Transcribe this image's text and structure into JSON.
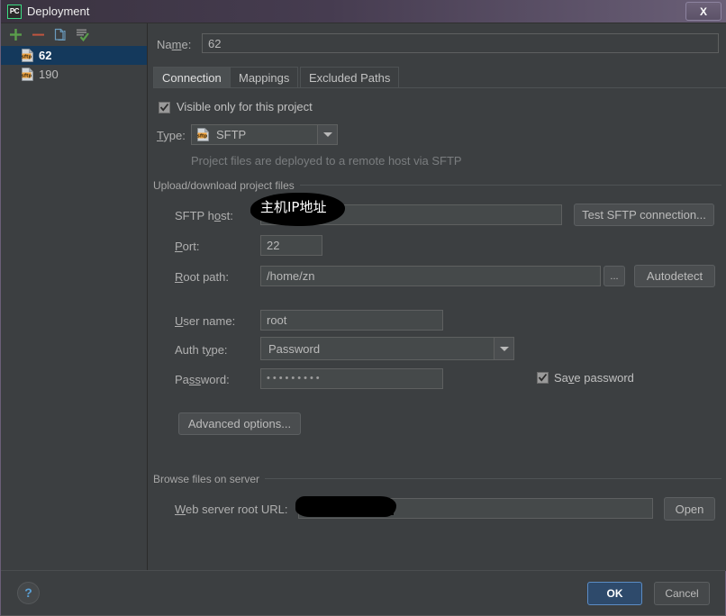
{
  "window": {
    "title": "Deployment",
    "app_icon": "pycharm-icon",
    "app_icon_text": "PC",
    "close_label": "X"
  },
  "toolbar": {
    "add": "add-icon",
    "remove": "remove-icon",
    "copy": "copy-icon",
    "set_default": "set-default-icon"
  },
  "server_list": {
    "items": [
      {
        "label": "62",
        "icon": "sftp-icon",
        "selected": true
      },
      {
        "label": "190",
        "icon": "sftp-icon",
        "selected": false
      }
    ]
  },
  "name_row": {
    "label_pre": "Na",
    "label_mnemonic": "m",
    "label_post": "e:",
    "value": "62"
  },
  "tabs": [
    {
      "label": "Connection",
      "active": true
    },
    {
      "label": "Mappings",
      "active": false
    },
    {
      "label": "Excluded Paths",
      "active": false
    }
  ],
  "connection": {
    "visible_only_checkbox": {
      "label": "Visible only for this project",
      "checked": true
    },
    "type_row": {
      "label_pre": "",
      "label_mnemonic": "T",
      "label_post": "ype:",
      "value": "SFTP",
      "icon": "sftp-icon"
    },
    "type_hint": "Project files are deployed to a remote host via SFTP",
    "upload_group": {
      "title": "Upload/download project files",
      "sftp_host": {
        "label_pre": "SFTP h",
        "label_mnemonic": "o",
        "label_post": "st:",
        "value": "",
        "redacted": true,
        "annotation": "主机IP地址"
      },
      "test_button": "Test SFTP connection...",
      "port": {
        "label_pre": "",
        "label_mnemonic": "P",
        "label_post": "ort:",
        "value": "22"
      },
      "root_path": {
        "label_pre": "",
        "label_mnemonic": "R",
        "label_post": "oot path:",
        "value": "/home/zn"
      },
      "browse_button": "...",
      "autodetect_button": "Autodetect",
      "user_name": {
        "label_pre": "",
        "label_mnemonic": "U",
        "label_post": "ser name:",
        "value": "root"
      },
      "auth_type": {
        "label_pre": "Auth t",
        "label_mnemonic": "y",
        "label_post": "pe:",
        "value": "Password"
      },
      "password": {
        "label_pre": "Pa",
        "label_mnemonic": "ss",
        "label_post": "word:",
        "value": "•••••••••"
      },
      "save_password_checkbox": {
        "label_pre": "Sa",
        "label_mnemonic": "v",
        "label_post": "e password",
        "checked": true
      },
      "advanced_button": "Advanced options..."
    },
    "browse_group": {
      "title": "Browse files on server",
      "web_url": {
        "label_pre": "",
        "label_mnemonic": "W",
        "label_post": "eb server root URL:",
        "value": "",
        "redacted": true
      },
      "open_button": "Open"
    }
  },
  "footer": {
    "help": "?",
    "ok": "OK",
    "cancel": "Cancel"
  }
}
